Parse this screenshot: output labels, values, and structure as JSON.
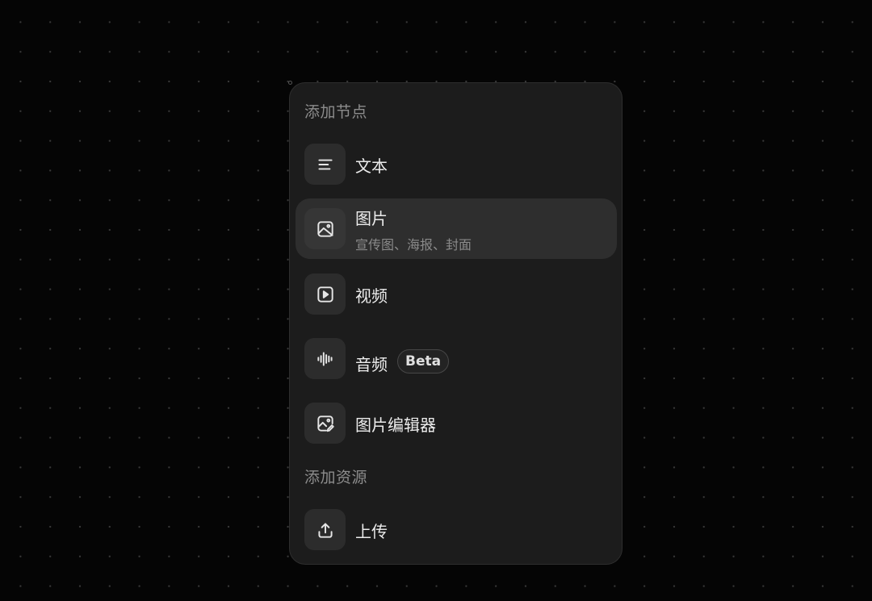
{
  "menu": {
    "section_nodes_title": "添加节点",
    "section_assets_title": "添加资源",
    "items": [
      {
        "id": "text",
        "label": "文本",
        "icon": "align-left-icon"
      },
      {
        "id": "image",
        "label": "图片",
        "sublabel": "宣传图、海报、封面",
        "icon": "image-icon",
        "highlighted": true
      },
      {
        "id": "video",
        "label": "视频",
        "icon": "play-square-icon"
      },
      {
        "id": "audio",
        "label": "音频",
        "badge": "Beta",
        "icon": "waveform-icon"
      },
      {
        "id": "image-editor",
        "label": "图片编辑器",
        "icon": "image-edit-icon"
      }
    ],
    "upload": {
      "label": "上传",
      "icon": "upload-icon"
    }
  },
  "colors": {
    "background": "#050505",
    "panel": "#1c1c1c",
    "highlight": "#2e2e2e",
    "icon_box": "#2c2c2c",
    "text_primary": "#ececec",
    "text_secondary": "#8c8c8c"
  }
}
